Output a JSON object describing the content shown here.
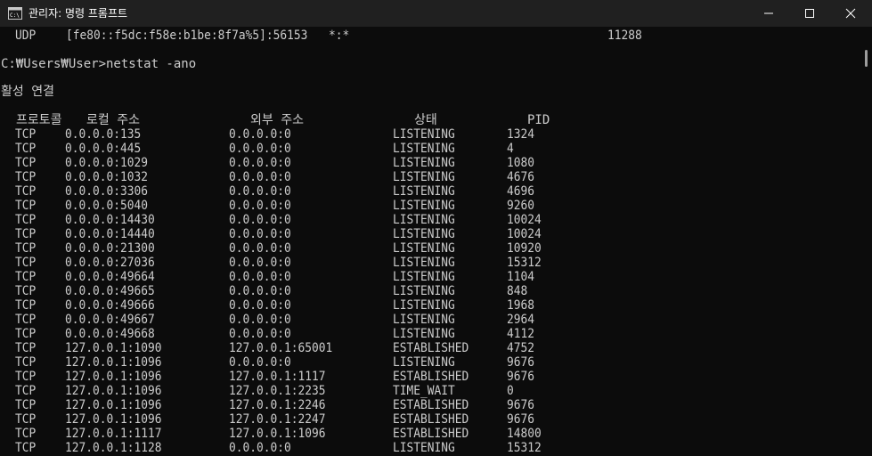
{
  "window": {
    "title": "관리자: 명령 프롬프트"
  },
  "colors": {
    "background": "#0c0c0c",
    "text": "#cccccc",
    "titlebar": "#202020"
  },
  "console": {
    "udp_line": {
      "proto": "UDP",
      "local": "[fe80::f5dc:f58e:b1be:8f7a%5]:56153",
      "foreign": "*:*",
      "pid": "11288"
    },
    "prompt": "C:₩Users₩User>netstat -ano",
    "section_title": "활성 연결",
    "headers": {
      "proto": "프로토콜",
      "local": "로컬 주소",
      "foreign": "외부 주소",
      "state": "상태",
      "pid": "PID"
    },
    "rows": [
      {
        "proto": "TCP",
        "local": "0.0.0.0:135",
        "foreign": "0.0.0.0:0",
        "state": "LISTENING",
        "pid": "1324"
      },
      {
        "proto": "TCP",
        "local": "0.0.0.0:445",
        "foreign": "0.0.0.0:0",
        "state": "LISTENING",
        "pid": "4"
      },
      {
        "proto": "TCP",
        "local": "0.0.0.0:1029",
        "foreign": "0.0.0.0:0",
        "state": "LISTENING",
        "pid": "1080"
      },
      {
        "proto": "TCP",
        "local": "0.0.0.0:1032",
        "foreign": "0.0.0.0:0",
        "state": "LISTENING",
        "pid": "4676"
      },
      {
        "proto": "TCP",
        "local": "0.0.0.0:3306",
        "foreign": "0.0.0.0:0",
        "state": "LISTENING",
        "pid": "4696"
      },
      {
        "proto": "TCP",
        "local": "0.0.0.0:5040",
        "foreign": "0.0.0.0:0",
        "state": "LISTENING",
        "pid": "9260"
      },
      {
        "proto": "TCP",
        "local": "0.0.0.0:14430",
        "foreign": "0.0.0.0:0",
        "state": "LISTENING",
        "pid": "10024"
      },
      {
        "proto": "TCP",
        "local": "0.0.0.0:14440",
        "foreign": "0.0.0.0:0",
        "state": "LISTENING",
        "pid": "10024"
      },
      {
        "proto": "TCP",
        "local": "0.0.0.0:21300",
        "foreign": "0.0.0.0:0",
        "state": "LISTENING",
        "pid": "10920"
      },
      {
        "proto": "TCP",
        "local": "0.0.0.0:27036",
        "foreign": "0.0.0.0:0",
        "state": "LISTENING",
        "pid": "15312"
      },
      {
        "proto": "TCP",
        "local": "0.0.0.0:49664",
        "foreign": "0.0.0.0:0",
        "state": "LISTENING",
        "pid": "1104"
      },
      {
        "proto": "TCP",
        "local": "0.0.0.0:49665",
        "foreign": "0.0.0.0:0",
        "state": "LISTENING",
        "pid": "848"
      },
      {
        "proto": "TCP",
        "local": "0.0.0.0:49666",
        "foreign": "0.0.0.0:0",
        "state": "LISTENING",
        "pid": "1968"
      },
      {
        "proto": "TCP",
        "local": "0.0.0.0:49667",
        "foreign": "0.0.0.0:0",
        "state": "LISTENING",
        "pid": "2964"
      },
      {
        "proto": "TCP",
        "local": "0.0.0.0:49668",
        "foreign": "0.0.0.0:0",
        "state": "LISTENING",
        "pid": "4112"
      },
      {
        "proto": "TCP",
        "local": "127.0.0.1:1090",
        "foreign": "127.0.0.1:65001",
        "state": "ESTABLISHED",
        "pid": "4752"
      },
      {
        "proto": "TCP",
        "local": "127.0.0.1:1096",
        "foreign": "0.0.0.0:0",
        "state": "LISTENING",
        "pid": "9676"
      },
      {
        "proto": "TCP",
        "local": "127.0.0.1:1096",
        "foreign": "127.0.0.1:1117",
        "state": "ESTABLISHED",
        "pid": "9676"
      },
      {
        "proto": "TCP",
        "local": "127.0.0.1:1096",
        "foreign": "127.0.0.1:2235",
        "state": "TIME_WAIT",
        "pid": "0"
      },
      {
        "proto": "TCP",
        "local": "127.0.0.1:1096",
        "foreign": "127.0.0.1:2246",
        "state": "ESTABLISHED",
        "pid": "9676"
      },
      {
        "proto": "TCP",
        "local": "127.0.0.1:1096",
        "foreign": "127.0.0.1:2247",
        "state": "ESTABLISHED",
        "pid": "9676"
      },
      {
        "proto": "TCP",
        "local": "127.0.0.1:1117",
        "foreign": "127.0.0.1:1096",
        "state": "ESTABLISHED",
        "pid": "14800"
      },
      {
        "proto": "TCP",
        "local": "127.0.0.1:1128",
        "foreign": "0.0.0.0:0",
        "state": "LISTENING",
        "pid": "15312"
      }
    ]
  }
}
